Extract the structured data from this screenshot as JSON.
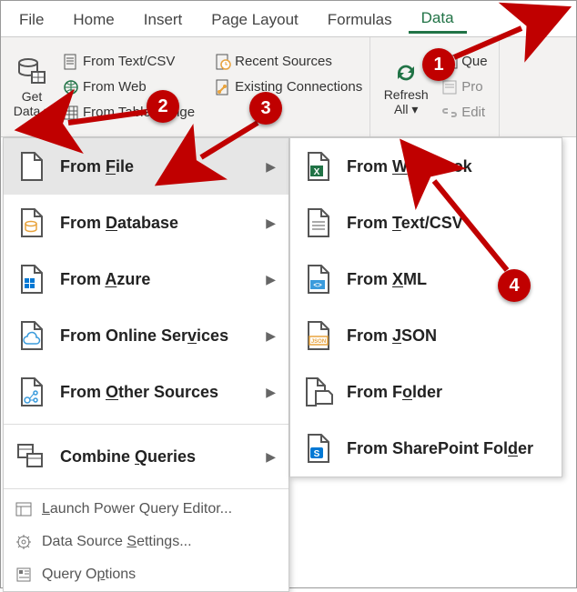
{
  "tabs": {
    "file": "File",
    "home": "Home",
    "insert": "Insert",
    "pagelayout": "Page Layout",
    "formulas": "Formulas",
    "data": "Data"
  },
  "ribbon": {
    "getdata_l1": "Get",
    "getdata_l2": "Data",
    "fromtextcsv": "From Text/CSV",
    "fromweb": "From Web",
    "fromtablerange": "From Table/Range",
    "recent": "Recent Sources",
    "existing": "Existing Connections",
    "refresh_l1": "Refresh",
    "refresh_l2": "All",
    "que": "Que",
    "pro": "Pro",
    "edit": "Edit"
  },
  "menu1": {
    "fromfile_pre": "From ",
    "fromfile_u": "F",
    "fromfile_post": "ile",
    "fromdb_pre": "From ",
    "fromdb_u": "D",
    "fromdb_post": "atabase",
    "fromazure_pre": "From ",
    "fromazure_u": "A",
    "fromazure_post": "zure",
    "fromonline_pre": "From Online Ser",
    "fromonline_u": "v",
    "fromonline_post": "ices",
    "fromother_pre": "From ",
    "fromother_u": "O",
    "fromother_post": "ther Sources",
    "combine_pre": "Combine ",
    "combine_u": "Q",
    "combine_post": "ueries",
    "launch_pre": "",
    "launch_u": "L",
    "launch_post": "aunch Power Query Editor...",
    "dss_pre": "Data Source ",
    "dss_u": "S",
    "dss_post": "ettings...",
    "qopt_pre": "Query O",
    "qopt_u": "p",
    "qopt_post": "tions"
  },
  "menu2": {
    "workbook_pre": "From ",
    "workbook_u": "W",
    "workbook_post": "orkbook",
    "textcsv_pre": "From ",
    "textcsv_u": "T",
    "textcsv_post": "ext/CSV",
    "xml_pre": "From ",
    "xml_u": "X",
    "xml_post": "ML",
    "json_pre": "From ",
    "json_u": "J",
    "json_post": "SON",
    "folder_pre": "From F",
    "folder_u": "o",
    "folder_post": "lder",
    "sp_pre": "From SharePoint Fol",
    "sp_u": "d",
    "sp_post": "er"
  },
  "annotations": {
    "b1": "1",
    "b2": "2",
    "b3": "3",
    "b4": "4"
  }
}
